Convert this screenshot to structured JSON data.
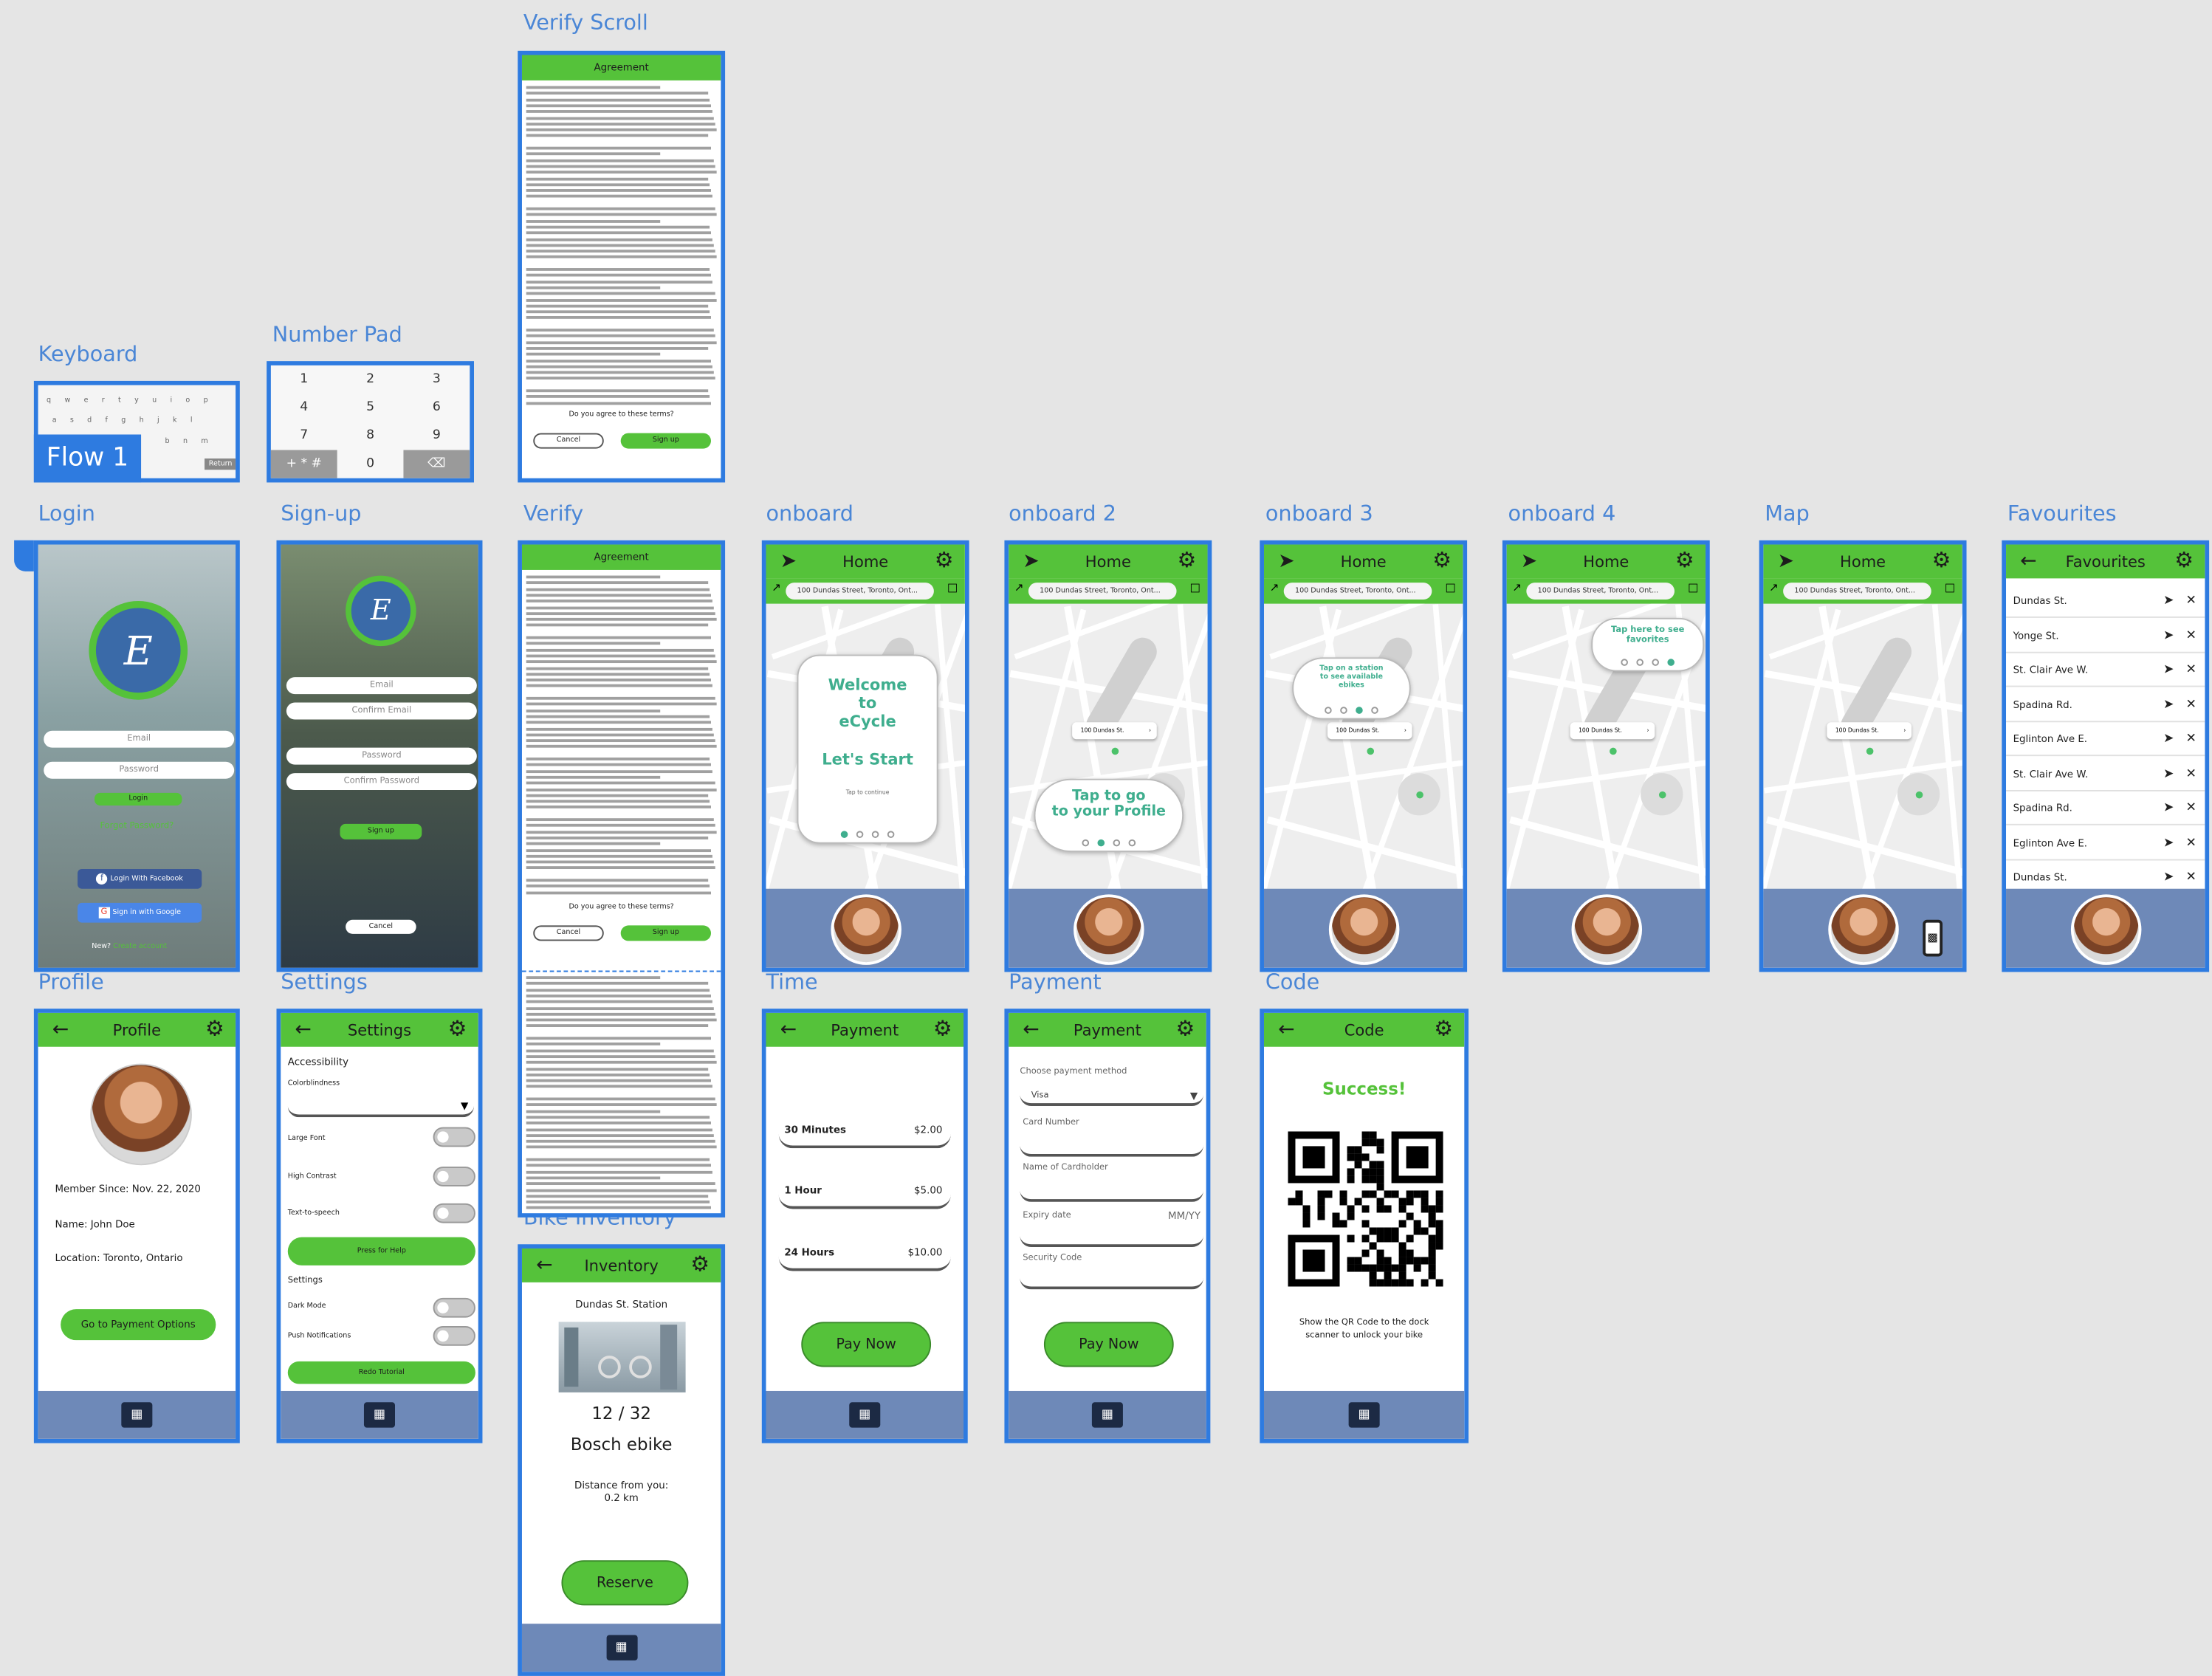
{
  "labels": {
    "verify_scroll": "Verify Scroll",
    "keyboard": "Keyboard",
    "number_pad": "Number Pad",
    "flow": "Flow 1",
    "login": "Login",
    "signup": "Sign-up",
    "verify": "Verify",
    "onboard": "onboard",
    "onboard2": "onboard 2",
    "onboard3": "onboard 3",
    "onboard4": "onboard 4",
    "map": "Map",
    "favourites": "Favourites",
    "profile": "Profile",
    "settings": "Settings",
    "time": "Time",
    "payment": "Payment",
    "code": "Code",
    "bike_inventory": "Bike Inventory"
  },
  "agreement": {
    "title": "Agreement",
    "question": "Do you agree to these terms?",
    "cancel": "Cancel",
    "signup": "Sign up"
  },
  "keyboard": {
    "keys": "q w e r t y u i o p",
    "keys2": "a s d f g h j k l",
    "keys3": "b n m",
    "return": "Return"
  },
  "numpad": {
    "keys": [
      "1",
      "2",
      "3",
      "4",
      "5",
      "6",
      "7",
      "8",
      "9",
      "+ * #",
      "0",
      "⌫"
    ]
  },
  "login": {
    "email": "Email",
    "password": "Password",
    "login": "Login",
    "forgot": "Forgot Password?",
    "facebook": "Login With Facebook",
    "google": "Sign in with Google",
    "new": "New?",
    "create": "Create account",
    "logo_letter": "E"
  },
  "signup": {
    "email": "Email",
    "confirm_email": "Confirm Email",
    "password": "Password",
    "confirm_password": "Confirm Password",
    "signup": "Sign up",
    "cancel": "Cancel",
    "logo_letter": "E"
  },
  "home": {
    "title": "Home",
    "address": "100 Dundas Street, Toronto, Ont...",
    "station": "100 Dundas St."
  },
  "onboard": {
    "welcome1": "Welcome",
    "welcome2": "to",
    "welcome3": "eCycle",
    "lets_start": "Let's Start",
    "tap_continue": "Tap to continue",
    "tap_profile1": "Tap to go",
    "tap_profile2": "to your Profile",
    "tap_station1": "Tap on a station",
    "tap_station2": "to see available",
    "tap_station3": "ebikes",
    "tap_fav1": "Tap here to see",
    "tap_fav2": "favorites"
  },
  "favourites": {
    "title": "Favourites",
    "items": [
      "Dundas St.",
      "Yonge St.",
      "St. Clair Ave W.",
      "Spadina Rd.",
      "Eglinton Ave E.",
      "St. Clair Ave W.",
      "Spadina Rd.",
      "Eglinton Ave E.",
      "Dundas St."
    ]
  },
  "profile": {
    "title": "Profile",
    "member": "Member Since: Nov. 22, 2020",
    "name": "Name: John Doe",
    "location": "Location: Toronto, Ontario",
    "payment_btn": "Go to Payment Options"
  },
  "settings": {
    "title": "Settings",
    "accessibility": "Accessibility",
    "colorblind": "Colorblindness",
    "large_font": "Large Font",
    "high_contrast": "High Contrast",
    "tts": "Text-to-speech",
    "help": "Press for Help",
    "settings": "Settings",
    "dark": "Dark Mode",
    "push": "Push Notifications",
    "redo": "Redo Tutorial"
  },
  "time": {
    "title": "Payment",
    "options": [
      {
        "label": "30 Minutes",
        "price": "$2.00"
      },
      {
        "label": "1 Hour",
        "price": "$5.00"
      },
      {
        "label": "24 Hours",
        "price": "$10.00"
      }
    ],
    "pay": "Pay Now"
  },
  "payment": {
    "title": "Payment",
    "choose": "Choose payment method",
    "method": "Visa",
    "card": "Card Number",
    "name": "Name of Cardholder",
    "expiry": "Expiry date",
    "mmyy": "MM/YY",
    "security": "Security Code",
    "pay": "Pay Now"
  },
  "code": {
    "title": "Code",
    "success": "Success!",
    "hint1": "Show the QR Code to the dock",
    "hint2": "scanner to unlock your bike"
  },
  "inventory": {
    "title": "Inventory",
    "station": "Dundas St. Station",
    "count": "12 / 32",
    "bike": "Bosch ebike",
    "distance1": "Distance from you:",
    "distance2": "0.2 km",
    "reserve": "Reserve"
  },
  "colors": {
    "accent_green": "#55c23a",
    "frame_blue": "#2e7be0",
    "bar_blue": "#6e89b8",
    "teal": "#3fae8e"
  },
  "icons": [
    "back-arrow-icon",
    "gear-icon",
    "navigation-arrow-icon",
    "close-icon",
    "home-icon",
    "pin-icon",
    "bookmark-icon",
    "qr-code-icon",
    "facebook-icon",
    "google-icon"
  ]
}
